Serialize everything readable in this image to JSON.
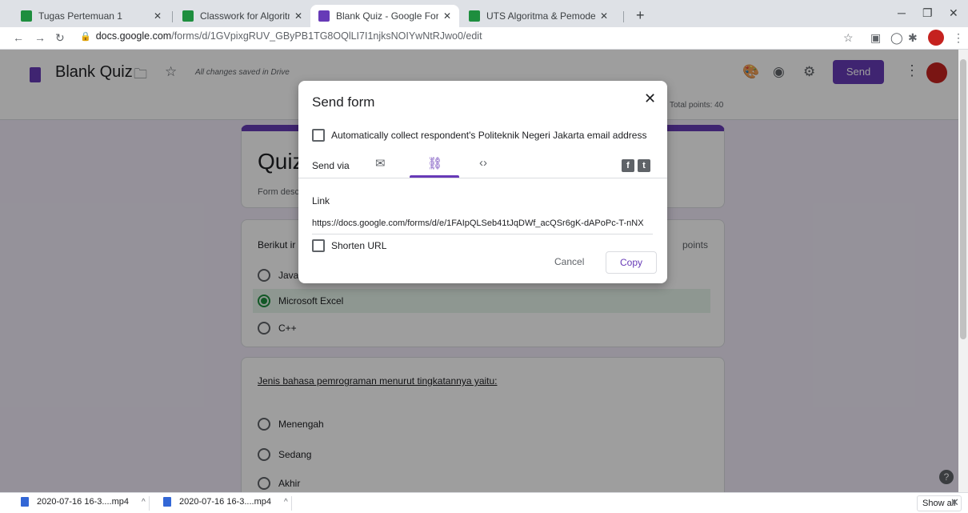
{
  "browser": {
    "tabs": [
      {
        "title": "Tugas Pertemuan 1",
        "icon": "classroom-icon"
      },
      {
        "title": "Classwork for Algoritma & Pemrc",
        "icon": "classroom-icon"
      },
      {
        "title": "Blank Quiz - Google Forms",
        "icon": "forms-icon"
      },
      {
        "title": "UTS Algoritma & Pemodelan",
        "icon": "classroom-icon"
      }
    ],
    "url_host": "docs.google.com",
    "url_path": "/forms/d/1GVpixgRUV_GByPB1TG8OQlLI7I1njksNOIYwNtRJwo0/edit"
  },
  "form_header": {
    "title": "Blank Quiz",
    "saved_status": "All changes saved in Drive",
    "send_label": "Send",
    "total_points": "Total points: 40"
  },
  "form": {
    "title": "Quiz",
    "description": "Form desc",
    "question1": {
      "text": "Berikut ir",
      "points": "points",
      "options": [
        "Java",
        "Microsoft Excel",
        "C++"
      ],
      "selected_index": 1
    },
    "question2": {
      "text": "Jenis bahasa pemrograman menurut tingkatannya yaitu:",
      "options": [
        "Menengah",
        "Sedang",
        "Akhir"
      ]
    }
  },
  "modal": {
    "title": "Send form",
    "auto_collect": "Automatically collect respondent's Politeknik Negeri Jakarta email address",
    "send_via": "Send via",
    "link_label": "Link",
    "link_url": "https://docs.google.com/forms/d/e/1FAIpQLSeb41tJqDWf_acQSr6gK-dAPoPc-T-nNX",
    "shorten_url": "Shorten URL",
    "cancel": "Cancel",
    "copy": "Copy"
  },
  "downloads": [
    {
      "name": "2020-07-16 16-3....mp4"
    },
    {
      "name": "2020-07-16 16-3....mp4"
    }
  ],
  "download_bar": {
    "show_all": "Show all"
  }
}
